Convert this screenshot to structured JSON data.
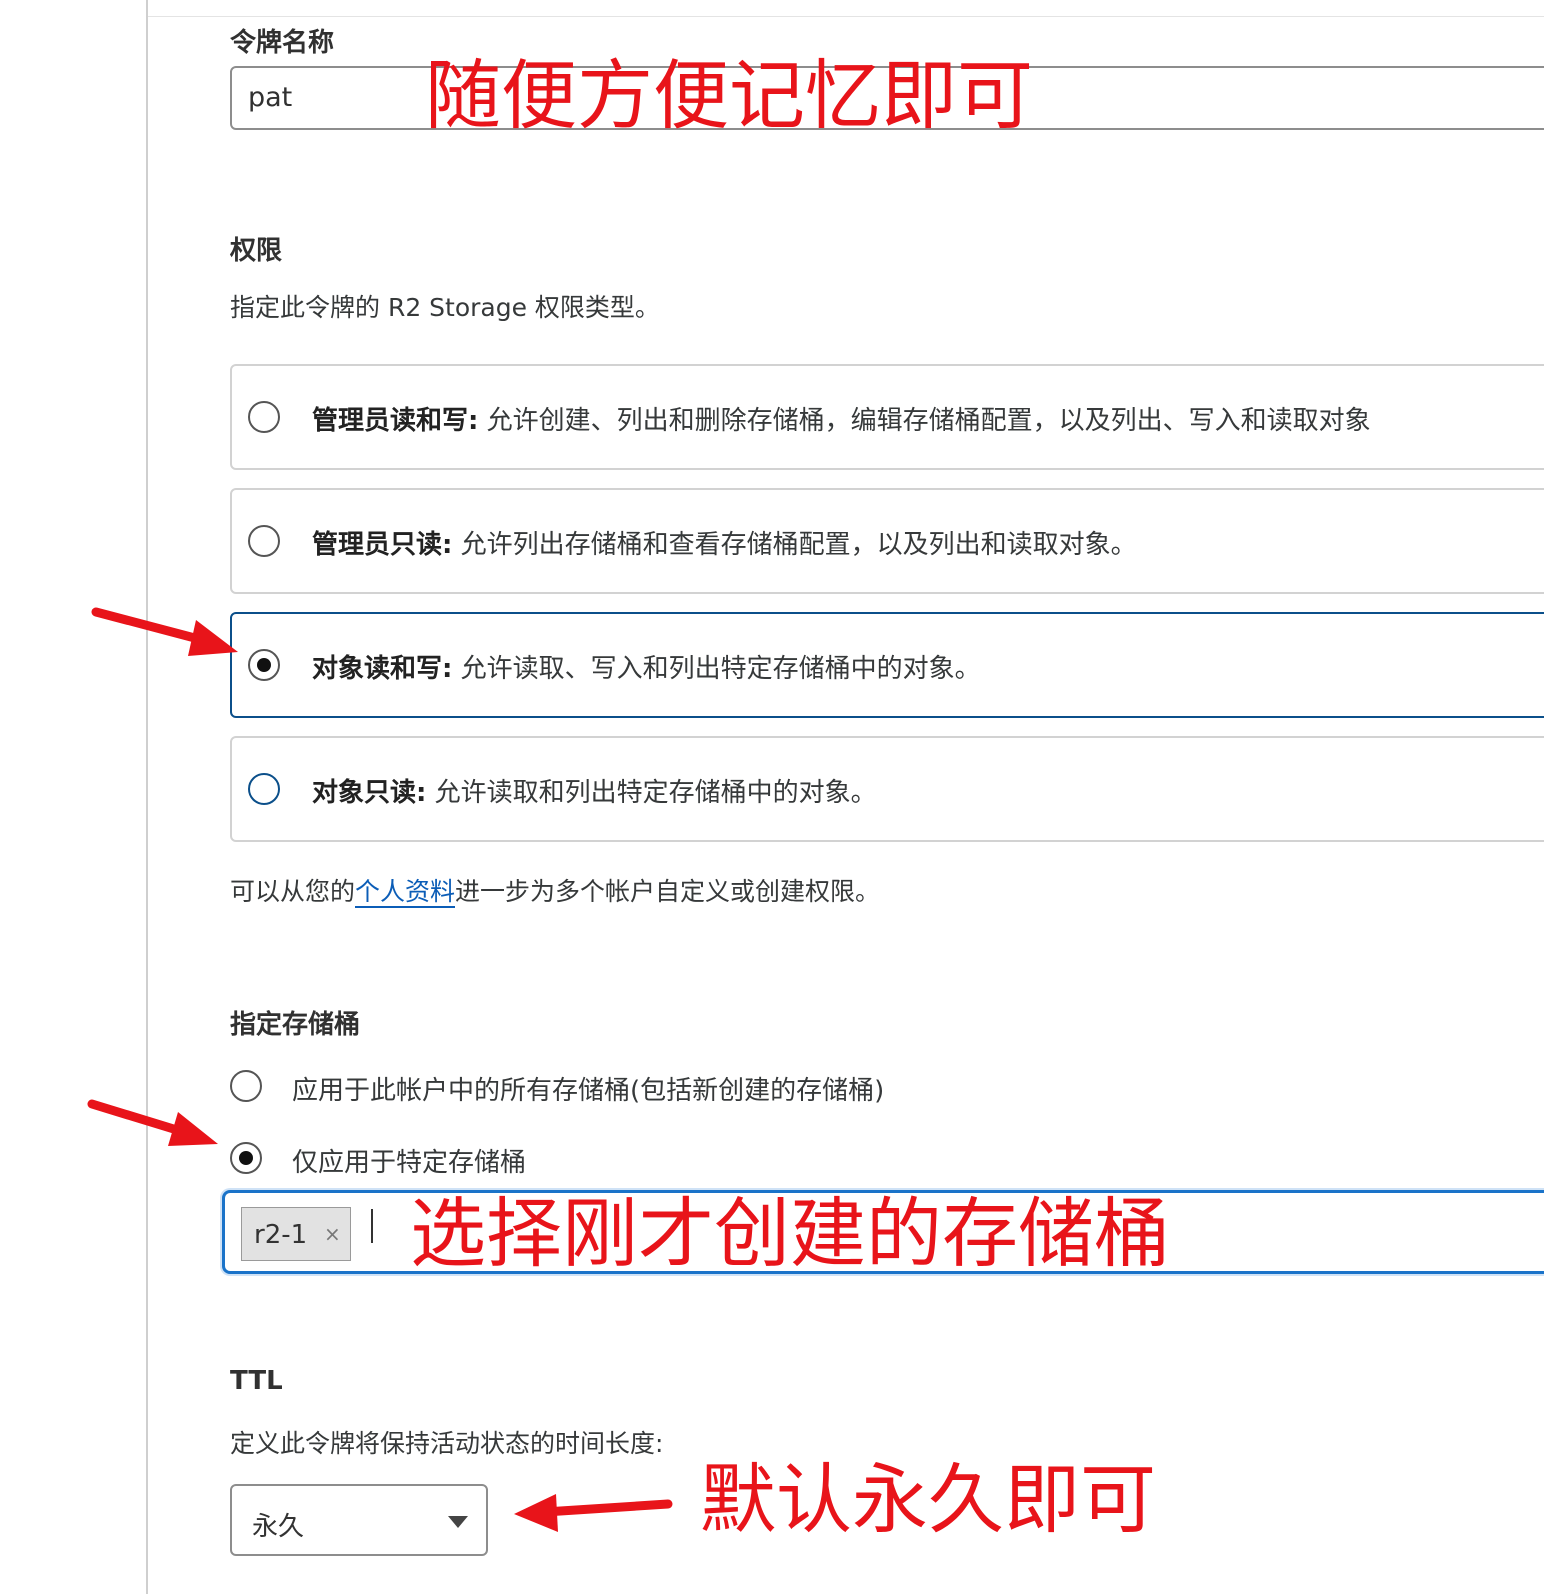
{
  "token_name": {
    "label": "令牌名称",
    "value": "pat"
  },
  "permissions": {
    "label": "权限",
    "description": "指定此令牌的 R2 Storage 权限类型。",
    "options": [
      {
        "title": "管理员读和写:",
        "text": "允许创建、列出和删除存储桶，编辑存储桶配置，以及列出、写入和读取对象",
        "selected": false
      },
      {
        "title": "管理员只读:",
        "text": "允许列出存储桶和查看存储桶配置，以及列出和读取对象。",
        "selected": false
      },
      {
        "title": "对象读和写:",
        "text": "允许读取、写入和列出特定存储桶中的对象。",
        "selected": true
      },
      {
        "title": "对象只读:",
        "text": "允许读取和列出特定存储桶中的对象。",
        "selected": false
      }
    ],
    "footer_prefix": "可以从您的",
    "footer_link": "个人资料",
    "footer_suffix": "进一步为多个帐户自定义或创建权限。"
  },
  "buckets": {
    "label": "指定存储桶",
    "options": [
      {
        "text": "应用于此帐户中的所有存储桶(包括新创建的存储桶)",
        "selected": false
      },
      {
        "text": "仅应用于特定存储桶",
        "selected": true
      }
    ],
    "selected_chip": "r2-1",
    "chip_close": "×"
  },
  "ttl": {
    "label": "TTL",
    "description": "定义此令牌将保持活动状态的时间长度:",
    "value": "永久"
  },
  "annotations": {
    "name_hint": "随便方便记忆即可",
    "bucket_hint": "选择刚才创建的存储桶",
    "ttl_hint": "默认永久即可",
    "color": "#e8141a"
  },
  "colors": {
    "selected_border": "#0b4f8a",
    "link": "#0b5db7",
    "focus_border": "#1a73c9"
  }
}
